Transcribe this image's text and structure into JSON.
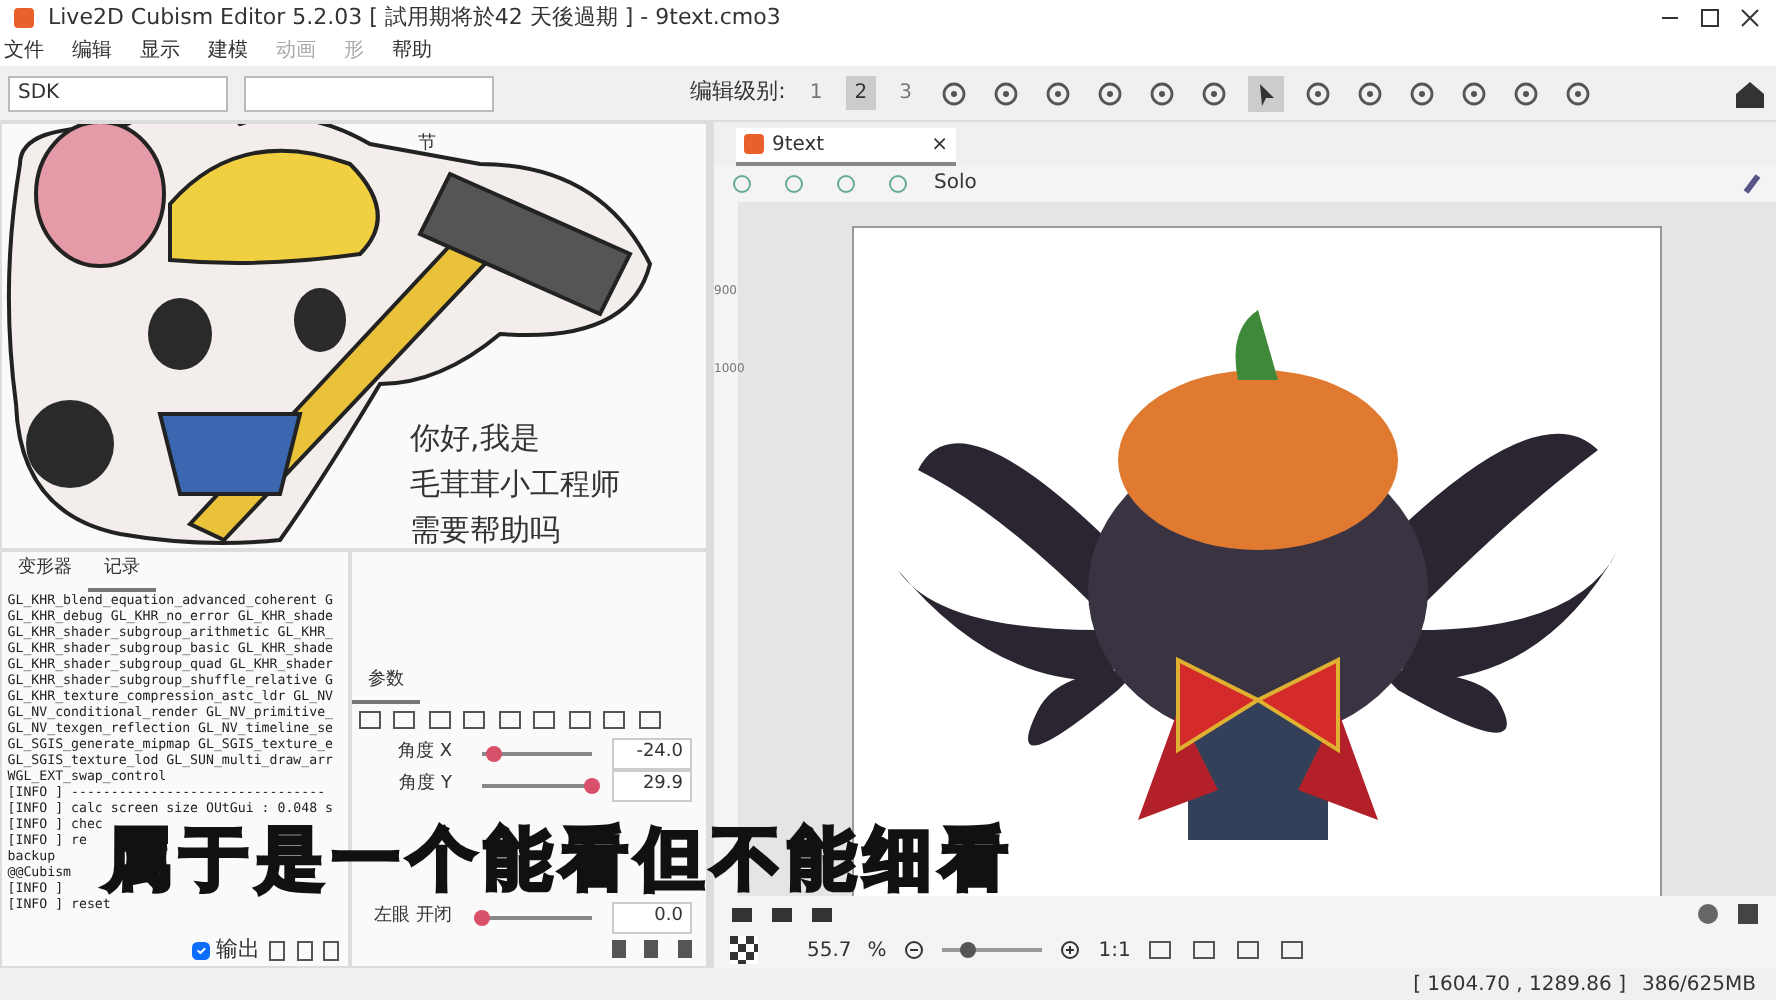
{
  "window": {
    "title": "Live2D Cubism Editor 5.2.03   [ 試用期将於42 天後過期 ] - 9text.cmo3"
  },
  "menu": [
    {
      "label": "文件",
      "disabled": false
    },
    {
      "label": "编辑",
      "disabled": false
    },
    {
      "label": "显示",
      "disabled": false
    },
    {
      "label": "建模",
      "disabled": false
    },
    {
      "label": "动画",
      "disabled": true
    },
    {
      "label": "形",
      "disabled": true
    },
    {
      "label": "帮助",
      "disabled": false
    }
  ],
  "toolbar": {
    "dropdown_1": "SDK",
    "edit_level_label": "编辑级别:",
    "edit_levels": [
      {
        "label": "1",
        "selected": false
      },
      {
        "label": "2",
        "selected": true
      },
      {
        "label": "3",
        "selected": false
      }
    ]
  },
  "top_panel": {
    "title": "节"
  },
  "log_panel": {
    "tabs": [
      {
        "label": "变形器",
        "selected": false
      },
      {
        "label": "记录",
        "selected": true
      }
    ],
    "lines": [
      "GL_KHR_blend_equation_advanced_coherent G",
      "GL_KHR_debug GL_KHR_no_error GL_KHR_shade",
      "GL_KHR_shader_subgroup_arithmetic GL_KHR_",
      "GL_KHR_shader_subgroup_basic GL_KHR_shade",
      "GL_KHR_shader_subgroup_quad GL_KHR_shader",
      "GL_KHR_shader_subgroup_shuffle_relative G",
      "GL_KHR_texture_compression_astc_ldr GL_NV",
      "GL_NV_conditional_render GL_NV_primitive_",
      "GL_NV_texgen_reflection GL_NV_timeline_se",
      "GL_SGIS_generate_mipmap GL_SGIS_texture_e",
      "GL_SGIS_texture_lod GL_SUN_multi_draw_arr",
      "WGL_EXT_swap_control",
      "[INFO ] --------------------------------",
      "[INFO ] calc screen size OUtGui : 0.048 s",
      "[INFO ] chec",
      "[INFO ] re",
      "backup",
      "@@Cubism",
      "[INFO ]",
      "[INFO ] reset"
    ],
    "output": {
      "label": "输出",
      "checked": true
    }
  },
  "parameters": {
    "title": "参数",
    "rows": [
      {
        "name": "角度 X",
        "level": 0.1,
        "value": "-24.0"
      },
      {
        "name": "角度 Y",
        "level": 1,
        "value": "29.9"
      },
      {
        "name": "左眼 开闭",
        "level": 0,
        "value": "0.0"
      }
    ]
  },
  "canvas": {
    "tab": {
      "label": "9text",
      "close": "×"
    },
    "solo": "Solo",
    "ruler": [
      "900",
      "1000"
    ],
    "zoom": "55.7",
    "zoom_unit": "%",
    "zoom_slider": {
      "level": 0.25
    },
    "one_to_one": "1:1"
  },
  "sticker": {
    "speech": [
      "你好,我是",
      "毛茸茸小工程师",
      "需要帮助吗"
    ]
  },
  "subtitle": "属于是一个能看但不能细看",
  "status_bar": {
    "coordinates": "[ 1604.70 , 1289.86 ]",
    "memory": "386/625MB"
  }
}
